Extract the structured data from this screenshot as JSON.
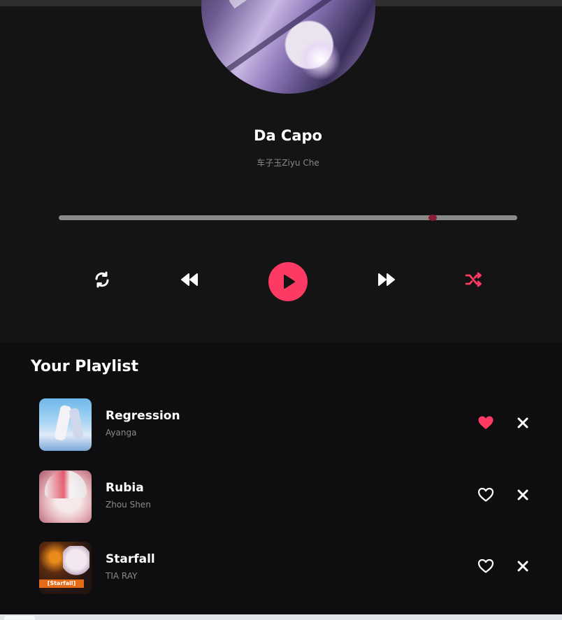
{
  "now_playing": {
    "title": "Da Capo",
    "artist": "车子玉Ziyu Che",
    "progress": 0.815,
    "cover_icon": "album-cover"
  },
  "controls": {
    "repeat_icon": "repeat-icon",
    "prev_icon": "rewind-icon",
    "play_icon": "play-icon",
    "next_icon": "fast-forward-icon",
    "shuffle_icon": "shuffle-icon"
  },
  "playlist": {
    "heading": "Your Playlist",
    "tracks": [
      {
        "title": "Regression",
        "artist": "Ayanga",
        "liked": true
      },
      {
        "title": "Rubia",
        "artist": "Zhou Shen",
        "liked": false
      },
      {
        "title": "Starfall",
        "artist": "TIA RAY",
        "liked": false,
        "cover_caption": "[Starfall]"
      }
    ]
  },
  "colors": {
    "accent": "#fd3a63",
    "background": "#141414",
    "playlist_background": "#0e0e10",
    "muted_text": "#8a8a8a",
    "progress_thumb": "#8b1a36"
  }
}
